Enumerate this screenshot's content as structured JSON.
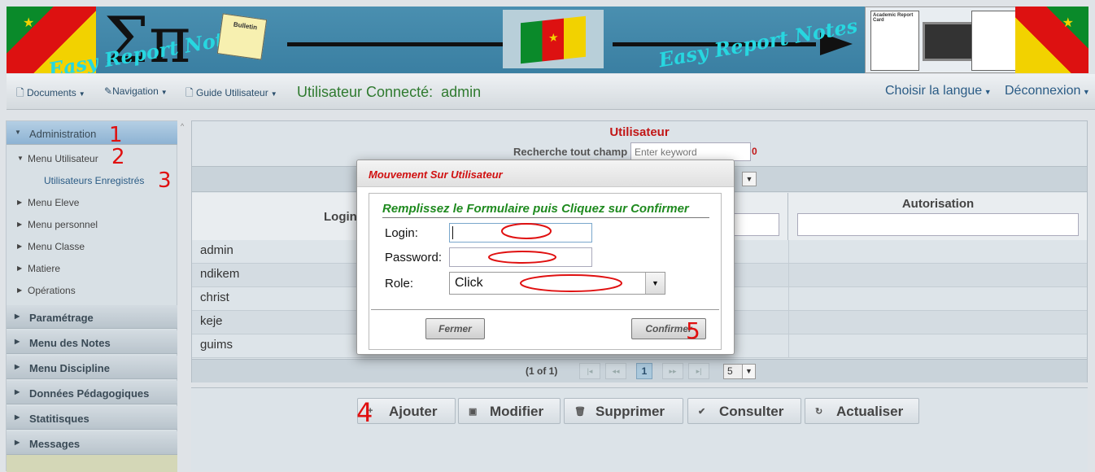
{
  "banner": {
    "brand_text": "Easy Report Notes",
    "brand_text_2": "Easy Report Notes",
    "bulletin_label": "Bulletin",
    "report_label": "Academic Report Card"
  },
  "navbar": {
    "documents": "Documents",
    "navigation": "Navigation",
    "guide": "Guide Utilisateur",
    "user_label": "Utilisateur Connecté:",
    "user_name": "admin",
    "language": "Choisir la langue",
    "logout": "Déconnexion"
  },
  "sidebar": {
    "administration": "Administration",
    "menu_utilisateur": "Menu Utilisateur",
    "utilisateurs_enregistres": "Utilisateurs Enregistrés",
    "sub_items": [
      "Menu Eleve",
      "Menu personnel",
      "Menu Classe",
      "Matiere",
      "Opérations"
    ],
    "sections": [
      "Paramétrage",
      "Menu des Notes",
      "Menu Discipline",
      "Données Pédagogiques",
      "Statitisques",
      "Messages"
    ]
  },
  "panel": {
    "title": "Utilisateur",
    "search_label": "Recherche tout champ",
    "search_placeholder": "Enter keyword",
    "search_count": "0",
    "col_login": "Login",
    "col_autorisation": "Autorisation",
    "rows": [
      "admin",
      "ndikem",
      "christ",
      "keje",
      "guims"
    ],
    "pager_text": "(1 of 1)",
    "current_page": "1",
    "page_size": "5"
  },
  "actions": {
    "ajouter": "Ajouter",
    "modifier": "Modifier",
    "supprimer": "Supprimer",
    "consulter": "Consulter",
    "actualiser": "Actualiser"
  },
  "dialog": {
    "title": "Mouvement Sur Utilisateur",
    "form_title": "Remplissez le Formulaire puis Cliquez sur Confirmer",
    "login_label": "Login:",
    "password_label": "Password:",
    "role_label": "Role:",
    "role_value": "Click",
    "close_label": "Fermer",
    "confirm_label": "Confirmer"
  },
  "annotations": [
    "1",
    "2",
    "3",
    "4",
    "5"
  ],
  "colors": {
    "accent_red": "#c21616",
    "green": "#1f8a1f",
    "annotation": "#e01010"
  }
}
